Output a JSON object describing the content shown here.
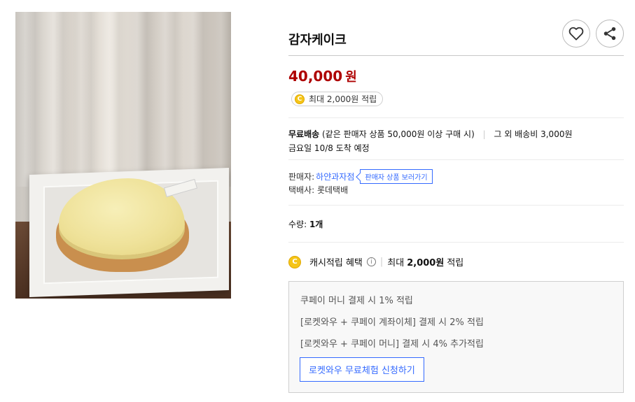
{
  "product": {
    "title": "감자케이크",
    "price": "40,000",
    "price_unit": "원",
    "reward": "최대 2,000원 적립",
    "coin_label": "C"
  },
  "shipping": {
    "free_label": "무료배송",
    "condition": "(같은 판매자 상품 50,000원 이상 구매 시)",
    "other_fee": "그 외 배송비 3,000원",
    "arrival": "금요일 10/8 도착 예정"
  },
  "seller": {
    "label": "판매자:",
    "name": "하얀과자점",
    "button": "판매자 상품 보러가기",
    "courier": "택배사: 롯데택배"
  },
  "quantity": {
    "label": "수량:",
    "value": "1개"
  },
  "cash": {
    "label": "캐시적립 혜택",
    "max_prefix": "최대",
    "max_value": "2,000원",
    "max_suffix": "적립"
  },
  "benefits": {
    "lines": [
      "쿠페이 머니 결제 시 1% 적립",
      "[로켓와우 + 쿠페이 계좌이체] 결제 시 2% 적립",
      "[로켓와우 + 쿠페이 머니] 결제 시 4% 추가적립"
    ],
    "button": "로켓와우 무료체험 신청하기"
  },
  "icons": {
    "heart": "heart-icon",
    "share": "share-icon",
    "info": "info-icon"
  },
  "colors": {
    "price": "#ae0000",
    "link": "#346aff",
    "coin": "#f5c518"
  }
}
